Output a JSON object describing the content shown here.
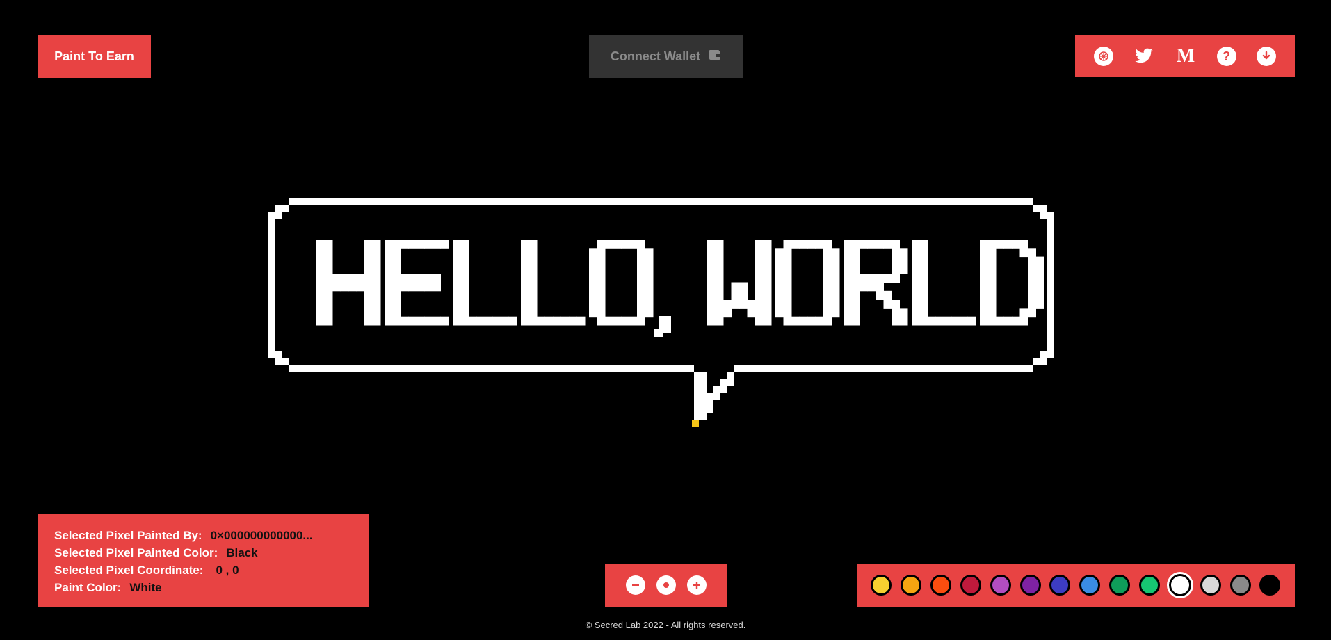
{
  "header": {
    "paint_to_earn_label": "Paint To Earn",
    "connect_wallet_label": "Connect Wallet"
  },
  "social": {
    "icons": [
      "opensea-icon",
      "twitter-icon",
      "medium-icon",
      "help-icon",
      "download-icon"
    ],
    "medium_glyph": "M",
    "help_glyph": "?"
  },
  "canvas_art": {
    "text": "HELLO, WORLD",
    "pixel_highlight_color": "#f5c518"
  },
  "info": {
    "painted_by_label": "Selected Pixel Painted By:",
    "painted_by_value": "0×000000000000...",
    "painted_color_label": "Selected Pixel Painted Color:",
    "painted_color_value": "Black",
    "coordinate_label": "Selected Pixel Coordinate:",
    "coordinate_value": "0 ,  0",
    "paint_color_label": "Paint Color:",
    "paint_color_value": "White"
  },
  "zoom": {
    "out_glyph": "−",
    "reset_glyph": "●",
    "in_glyph": "+"
  },
  "palette": {
    "colors": [
      "#f7d030",
      "#f5a511",
      "#fa4d0f",
      "#bf1a3c",
      "#b24dc0",
      "#7f22a3",
      "#3d3cc3",
      "#3a8ce4",
      "#0f9d5a",
      "#16c672",
      "#ffffff",
      "#d8d8d8",
      "#8a8a8a",
      "#000000"
    ],
    "selected_index": 10
  },
  "footer": {
    "copyright": "© Secred Lab 2022 - All rights reserved."
  },
  "theme": {
    "accent": "#e84343",
    "background": "#000000",
    "wallet_bg": "#333333"
  }
}
